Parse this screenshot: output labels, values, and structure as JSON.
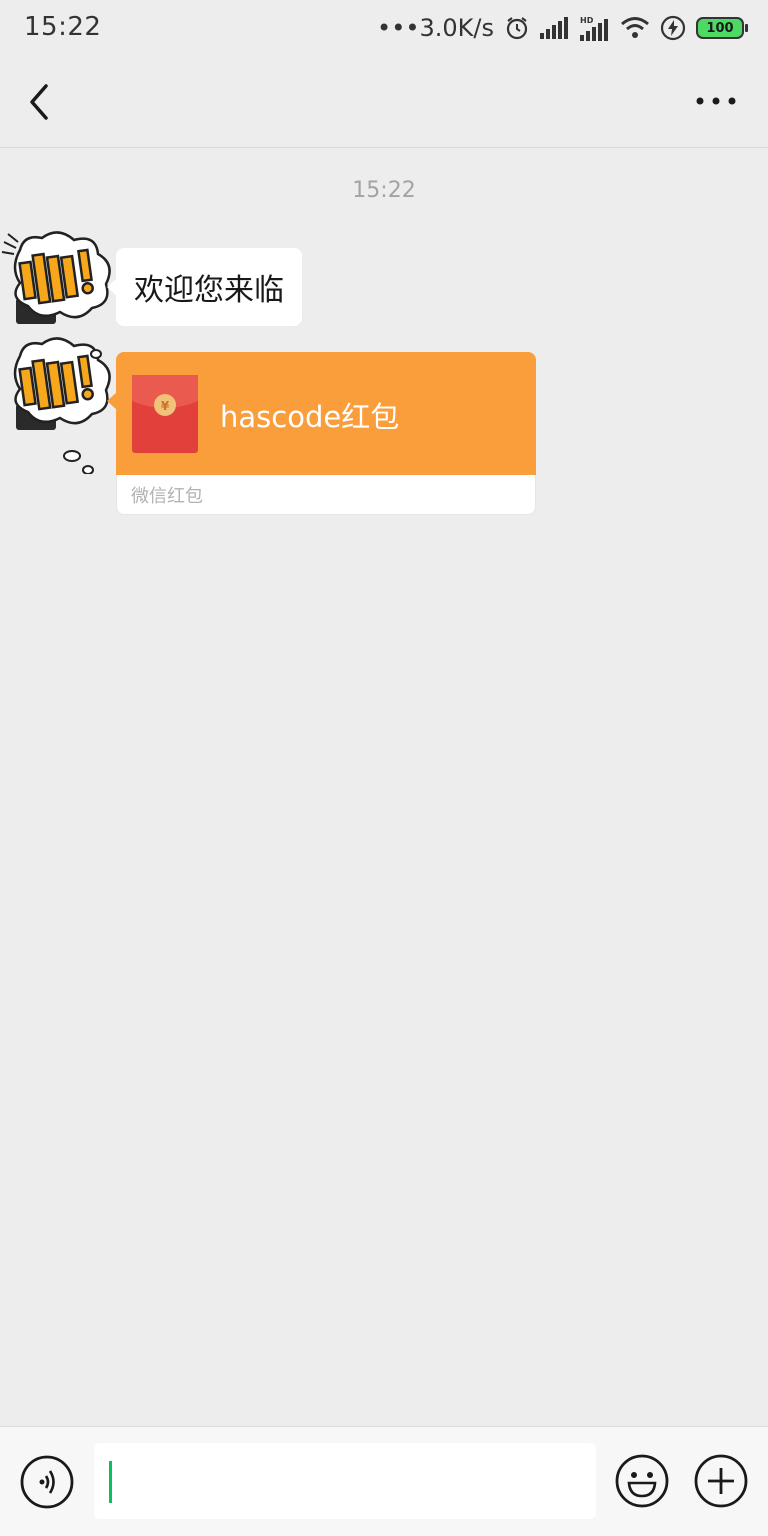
{
  "status_bar": {
    "time": "15:22",
    "network_speed": "•••3.0K/s",
    "battery_level": "100",
    "icons": [
      "alarm-icon",
      "signal-icon",
      "hd-signal-icon",
      "wifi-icon",
      "charging-icon",
      "battery-icon"
    ]
  },
  "nav": {
    "back_icon": "chevron-left-icon",
    "more_icon": "more-dots-icon"
  },
  "chat": {
    "timestamp": "15:22",
    "messages": [
      {
        "type": "text",
        "text": "欢迎您来临",
        "avatar": "avatar-shuai"
      },
      {
        "type": "red_packet",
        "title": "hascode红包",
        "footer": "微信红包",
        "avatar": "avatar-shuai"
      }
    ]
  },
  "input_bar": {
    "value": "",
    "voice_icon": "voice-icon",
    "emoji_icon": "emoji-icon",
    "plus_icon": "plus-icon"
  },
  "colors": {
    "background": "#ededed",
    "red_packet": "#fa9d3b",
    "cursor": "#07c160",
    "bubble": "#ffffff"
  }
}
